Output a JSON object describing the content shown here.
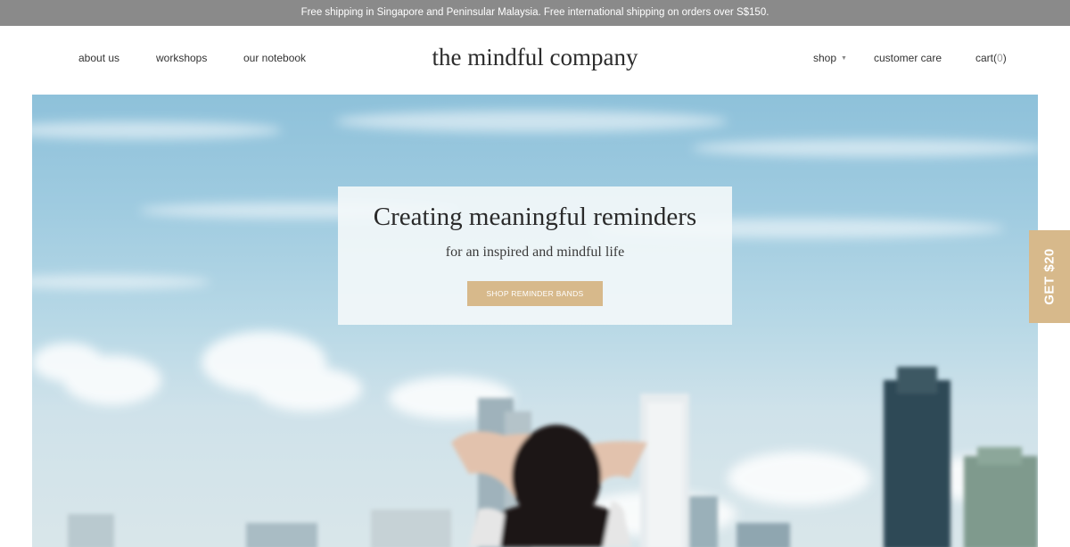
{
  "announcement": "Free shipping in Singapore and Peninsular Malaysia. Free international shipping on orders over S$150.",
  "nav": {
    "left": [
      "about us",
      "workshops",
      "our notebook"
    ],
    "brand": "the mindful company",
    "shop": "shop",
    "customer_care": "customer care",
    "cart_label": "cart",
    "cart_open": "(",
    "cart_count": "0",
    "cart_close": ")"
  },
  "hero": {
    "title": "Creating meaningful reminders",
    "subtitle": "for an inspired and mindful life",
    "button": "SHOP REMINDER BANDS"
  },
  "promo_tab": "GET $20",
  "colors": {
    "announcement_bg": "#8a8a8a",
    "accent": "#d7b98b",
    "sky": "#9fcbe0"
  },
  "icons": {
    "shop_dropdown": "chevron-down-icon"
  }
}
